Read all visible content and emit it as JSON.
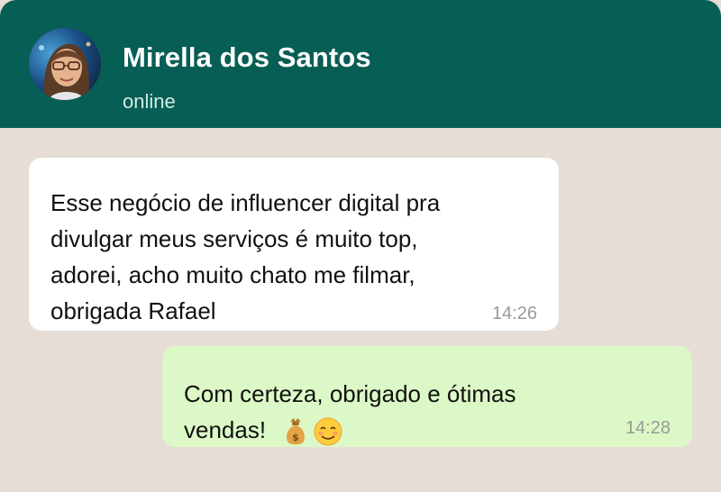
{
  "contact": {
    "name": "Mirella dos Santos",
    "status": "online"
  },
  "messages": [
    {
      "direction": "incoming",
      "text": "Esse negócio de influencer digital pra\ndivulgar meus serviços é muito top,\nadorei, acho muito chato me filmar,\nobrigada Rafael",
      "time": "14:26"
    },
    {
      "direction": "outgoing",
      "text": "Com certeza, obrigado e ótimas\nvendas!",
      "emojis": [
        "money-bag-icon",
        "smiling-face-icon"
      ],
      "time": "14:28"
    }
  ],
  "colors": {
    "header": "#075e54",
    "background": "#e5ddd6",
    "incoming_bubble": "#ffffff",
    "outgoing_bubble": "#dcf8c6"
  }
}
